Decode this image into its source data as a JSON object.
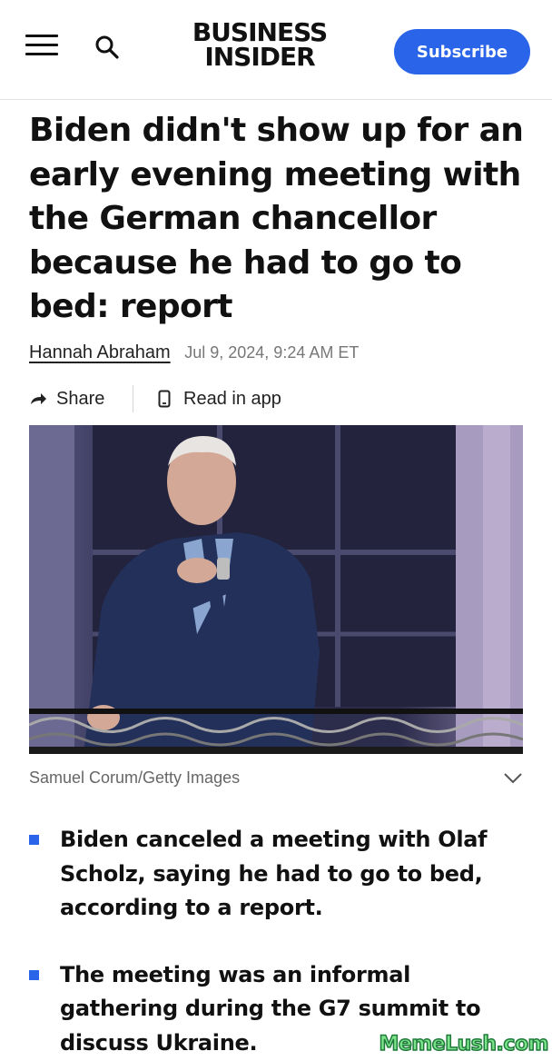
{
  "header": {
    "logo_line1": "BUSINESS",
    "logo_line2": "INSIDER",
    "subscribe_label": "Subscribe",
    "accent_color": "#2a64e8"
  },
  "article": {
    "headline": "Biden didn't show up for an early evening meeting with the German chancellor because he had to go to bed: report",
    "author": "Hannah Abraham",
    "date": "Jul 9, 2024, 9:24 AM ET",
    "share_label": "Share",
    "app_label": "Read in app",
    "photo_credit": "Samuel Corum/Getty Images",
    "bullets": [
      "Biden canceled a meeting with Olaf Scholz, saying he had to go to bed, according to a report.",
      "The meeting was an informal gathering during the G7 summit to discuss Ukraine."
    ]
  },
  "watermark": "MemeLush.com",
  "icons": {
    "menu": "menu-icon",
    "search": "search-icon",
    "share": "share-arrow-icon",
    "phone": "phone-icon",
    "chevron": "chevron-down-icon"
  }
}
